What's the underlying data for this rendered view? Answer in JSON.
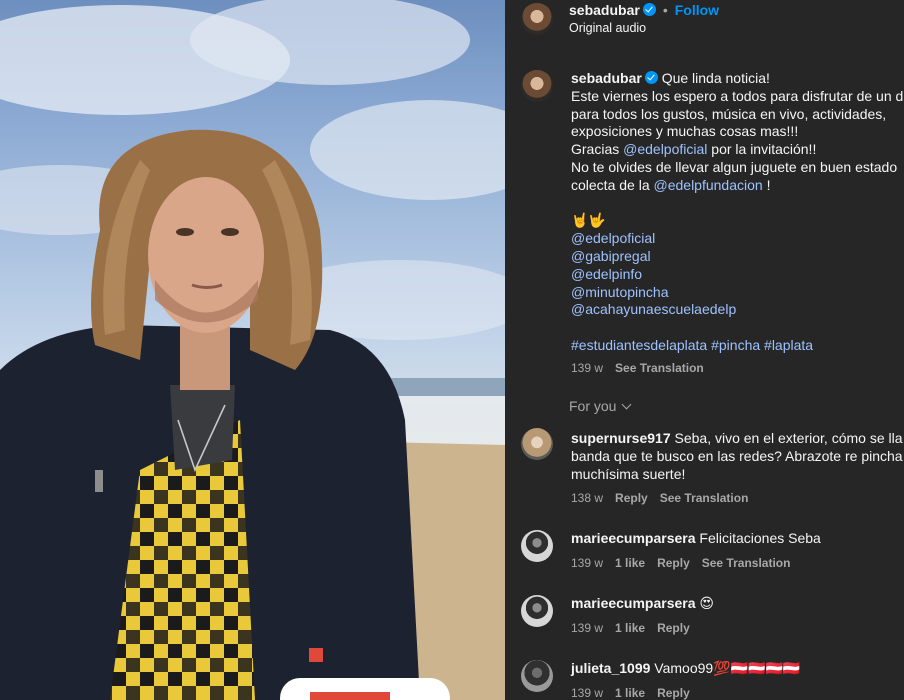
{
  "post": {
    "username": "sebadubar",
    "follow_label": "Follow",
    "audio": "Original audio"
  },
  "caption": {
    "username": "sebadubar",
    "line1": "Que linda noticia!",
    "line2": "Este viernes los espero a todos para disfrutar de un d",
    "line3": "para todos los gustos, música en vivo, actividades,",
    "line4": "exposiciones y muchas cosas mas!!!",
    "line5_a": "Gracias ",
    "line5_mention": "@edelpoficial",
    "line5_b": " por la invitación!!",
    "line6": "No te olvides de llevar algun juguete en buen estado",
    "line7_a": "colecta de la ",
    "line7_mention": "@edelpfundacion",
    "line7_b": " !",
    "emoji": "🤘🤟",
    "mentions": [
      "@edelpoficial",
      "@gabipregal",
      "@edelpinfo",
      "@minutopincha",
      "@acahayunaescuelaedelp"
    ],
    "hashtags": "#estudiantesdelaplata #pincha #laplata",
    "age": "139 w",
    "see_translation": "See Translation"
  },
  "for_you": "For you",
  "comments": [
    {
      "username": "supernurse917",
      "line1": "Seba, vivo en el exterior, cómo se lla",
      "line2": "banda que te busco en las redes? Abrazote re pincha",
      "line3": "muchísima suerte!",
      "age": "138 w",
      "reply": "Reply",
      "see_translation": "See Translation"
    },
    {
      "username": "marieecumparsera",
      "text": "Felicitaciones Seba",
      "age": "139 w",
      "likes": "1 like",
      "reply": "Reply",
      "see_translation": "See Translation"
    },
    {
      "username": "marieecumparsera",
      "text": "😍",
      "age": "139 w",
      "likes": "1 like",
      "reply": "Reply"
    },
    {
      "username": "julieta_1099",
      "text": "Vamoo99💯🇦🇹🇦🇹🇦🇹🇦🇹",
      "age": "139 w",
      "likes": "1 like",
      "reply": "Reply"
    }
  ]
}
